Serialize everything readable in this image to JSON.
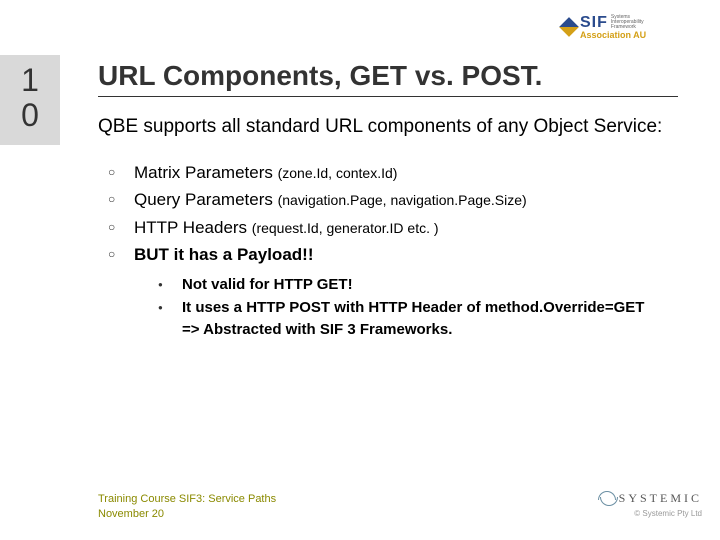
{
  "slide_number_top": "1",
  "slide_number_bottom": "0",
  "logo": {
    "sif": "SIF",
    "tagline1": "Systems",
    "tagline2": "Interoperability",
    "tagline3": "Framework",
    "assoc": "Association AU"
  },
  "title": "URL Components, GET vs. POST.",
  "subtitle": "QBE supports all standard URL components of any Object Service:",
  "bullets": [
    {
      "label": "Matrix Parameters ",
      "params": "(zone.Id, contex.Id)"
    },
    {
      "label": "Query Parameters ",
      "params": "(navigation.Page, navigation.Page.Size)"
    },
    {
      "label": "HTTP Headers ",
      "params": "(request.Id, generator.ID etc. )"
    },
    {
      "label": "BUT it has a Payload!!",
      "params": ""
    }
  ],
  "sub_bullets": [
    "Not valid for HTTP GET!",
    "It uses a HTTP POST with HTTP Header of method.Override=GET",
    "=> Abstracted with SIF 3 Frameworks."
  ],
  "footer": {
    "course": "Training Course SIF3: Service Paths",
    "date": "November 20"
  },
  "footer_logo": {
    "name": "SYSTEMIC",
    "copyright": "© Systemic Pty Ltd"
  }
}
